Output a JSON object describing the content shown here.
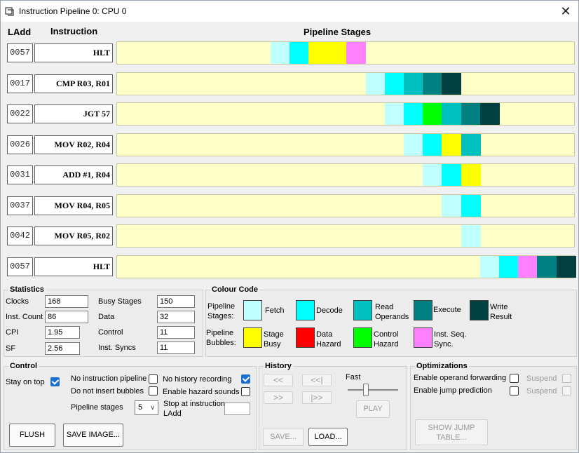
{
  "window": {
    "title": "Instruction Pipeline 0: CPU 0",
    "close_glyph": "✕"
  },
  "headers": {
    "ladd": "LAdd",
    "instruction": "Instruction",
    "stages": "Pipeline Stages"
  },
  "colors": {
    "fetch": "#c0ffff",
    "decode": "#00ffff",
    "read_operands": "#00c0c0",
    "execute": "#008080",
    "write_result": "#004040",
    "stage_busy": "#ffff00",
    "data_hazard": "#ff0000",
    "control_hazard": "#00ff00",
    "inst_seq_sync": "#ff80ff",
    "track_bg": "#ffffc8"
  },
  "rows": [
    {
      "addr": "0057",
      "instr": "HLT",
      "cells": [
        [
          "fetch",
          8
        ],
        [
          "decode",
          9
        ],
        [
          "stage_busy",
          10
        ],
        [
          "stage_busy",
          11
        ],
        [
          "inst_seq_sync",
          12
        ]
      ]
    },
    {
      "addr": "0017",
      "instr": "CMP R03, R01",
      "cells": [
        [
          "fetch",
          13
        ],
        [
          "decode",
          14
        ],
        [
          "read_operands",
          15
        ],
        [
          "execute",
          16
        ],
        [
          "write_result",
          17
        ]
      ]
    },
    {
      "addr": "0022",
      "instr": "JGT 57",
      "cells": [
        [
          "fetch",
          14
        ],
        [
          "decode",
          15
        ],
        [
          "control_hazard",
          16
        ],
        [
          "read_operands",
          17
        ],
        [
          "execute",
          18
        ],
        [
          "write_result",
          19
        ]
      ]
    },
    {
      "addr": "0026",
      "instr": "MOV R02, R04",
      "cells": [
        [
          "fetch",
          15
        ],
        [
          "decode",
          16
        ],
        [
          "stage_busy",
          17
        ],
        [
          "read_operands",
          18
        ]
      ]
    },
    {
      "addr": "0031",
      "instr": "ADD #1, R04",
      "cells": [
        [
          "fetch",
          16
        ],
        [
          "decode",
          17
        ],
        [
          "stage_busy",
          18
        ]
      ]
    },
    {
      "addr": "0037",
      "instr": "MOV R04, R05",
      "cells": [
        [
          "fetch",
          17
        ],
        [
          "decode",
          18
        ]
      ]
    },
    {
      "addr": "0042",
      "instr": "MOV R05, R02",
      "cells": [
        [
          "fetch",
          18
        ]
      ]
    },
    {
      "addr": "0057",
      "instr": "HLT",
      "cells": [
        [
          "fetch",
          19
        ],
        [
          "decode",
          20
        ],
        [
          "inst_seq_sync",
          21
        ],
        [
          "execute",
          22
        ],
        [
          "write_result",
          23
        ]
      ]
    }
  ],
  "statistics": {
    "title": "Statistics",
    "clocks_label": "Clocks",
    "clocks": "168",
    "inst_count_label": "Inst. Count",
    "inst_count": "86",
    "cpi_label": "CPI",
    "cpi": "1.95",
    "sf_label": "SF",
    "sf": "2.56",
    "busy_label": "Busy Stages",
    "busy": "150",
    "data_label": "Data",
    "data": "32",
    "control_label": "Control",
    "control": "11",
    "syncs_label": "Inst. Syncs",
    "syncs": "11"
  },
  "colour_code": {
    "title": "Colour Code",
    "stages_label": "Pipeline Stages:",
    "bubbles_label": "Pipeline Bubbles:",
    "fetch": "Fetch",
    "decode": "Decode",
    "read_operands": "Read Operands",
    "execute": "Execute",
    "write_result": "Write Result",
    "stage_busy": "Stage Busy",
    "data_hazard": "Data Hazard",
    "control_hazard": "Control Hazard",
    "inst_seq_sync": "Inst. Seq. Sync."
  },
  "control": {
    "title": "Control",
    "stay_on_top": "Stay on top",
    "no_pipeline": "No instruction pipeline",
    "no_bubbles": "Do not insert bubbles",
    "no_history": "No history recording",
    "hazard_sounds": "Enable hazard sounds",
    "stages_label": "Pipeline stages",
    "stages_value": "5",
    "stop_label": "Stop at instruction LAdd",
    "flush": "FLUSH",
    "save_image": "SAVE IMAGE..."
  },
  "history": {
    "title": "History",
    "back": "<<",
    "back_start": "<<|",
    "fwd": ">>",
    "fwd_end": "|>>",
    "fast": "Fast",
    "play": "PLAY",
    "save": "SAVE...",
    "load": "LOAD..."
  },
  "optimizations": {
    "title": "Optimizations",
    "operand_forwarding": "Enable operand forwarding",
    "jump_prediction": "Enable jump prediction",
    "suspend": "Suspend",
    "show_jump_table": "SHOW JUMP TABLE..."
  }
}
